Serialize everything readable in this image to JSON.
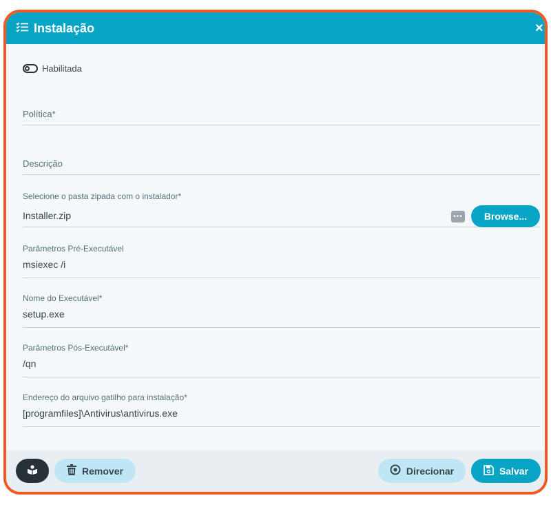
{
  "dialog": {
    "title": "Instalação",
    "close_label": "×"
  },
  "toggle": {
    "label": "Habilitada",
    "state": "off"
  },
  "fields": {
    "policy": {
      "label": "Política*",
      "value": ""
    },
    "description": {
      "label": "Descrição",
      "value": ""
    },
    "zip_folder": {
      "label": "Selecione o pasta zipada com o instalador*",
      "value": "Installer.zip",
      "browse_label": "Browse...",
      "dots_label": "•••"
    },
    "pre_params": {
      "label": "Parâmetros Pré-Executável",
      "value": "msiexec /i"
    },
    "exe_name": {
      "label": "Nome do Executável*",
      "value": "setup.exe"
    },
    "post_params": {
      "label": "Parâmetros Pós-Executável*",
      "value": "/qn"
    },
    "trigger_path": {
      "label": "Endereço do arquivo gatilho para instalação*",
      "value": "[programfiles]\\Antivirus\\antivirus.exe"
    }
  },
  "footer": {
    "remove_label": "Remover",
    "direct_label": "Direcionar",
    "save_label": "Salvar"
  },
  "colors": {
    "accent": "#08a4c6",
    "border": "#ee5a24",
    "dark": "#263238",
    "light_button": "#bfe6f4"
  }
}
